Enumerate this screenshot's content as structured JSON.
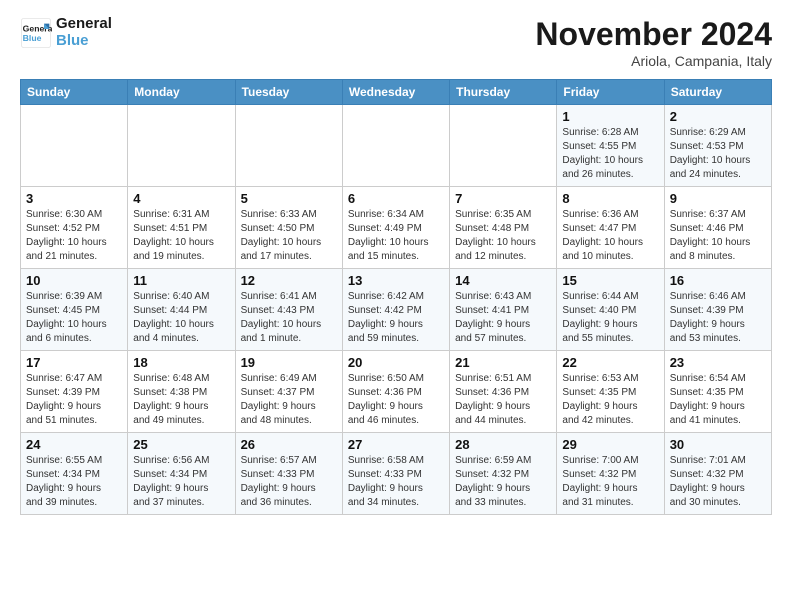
{
  "header": {
    "logo_line1": "General",
    "logo_line2": "Blue",
    "month_title": "November 2024",
    "subtitle": "Ariola, Campania, Italy"
  },
  "weekdays": [
    "Sunday",
    "Monday",
    "Tuesday",
    "Wednesday",
    "Thursday",
    "Friday",
    "Saturday"
  ],
  "weeks": [
    [
      {
        "day": "",
        "info": ""
      },
      {
        "day": "",
        "info": ""
      },
      {
        "day": "",
        "info": ""
      },
      {
        "day": "",
        "info": ""
      },
      {
        "day": "",
        "info": ""
      },
      {
        "day": "1",
        "info": "Sunrise: 6:28 AM\nSunset: 4:55 PM\nDaylight: 10 hours\nand 26 minutes."
      },
      {
        "day": "2",
        "info": "Sunrise: 6:29 AM\nSunset: 4:53 PM\nDaylight: 10 hours\nand 24 minutes."
      }
    ],
    [
      {
        "day": "3",
        "info": "Sunrise: 6:30 AM\nSunset: 4:52 PM\nDaylight: 10 hours\nand 21 minutes."
      },
      {
        "day": "4",
        "info": "Sunrise: 6:31 AM\nSunset: 4:51 PM\nDaylight: 10 hours\nand 19 minutes."
      },
      {
        "day": "5",
        "info": "Sunrise: 6:33 AM\nSunset: 4:50 PM\nDaylight: 10 hours\nand 17 minutes."
      },
      {
        "day": "6",
        "info": "Sunrise: 6:34 AM\nSunset: 4:49 PM\nDaylight: 10 hours\nand 15 minutes."
      },
      {
        "day": "7",
        "info": "Sunrise: 6:35 AM\nSunset: 4:48 PM\nDaylight: 10 hours\nand 12 minutes."
      },
      {
        "day": "8",
        "info": "Sunrise: 6:36 AM\nSunset: 4:47 PM\nDaylight: 10 hours\nand 10 minutes."
      },
      {
        "day": "9",
        "info": "Sunrise: 6:37 AM\nSunset: 4:46 PM\nDaylight: 10 hours\nand 8 minutes."
      }
    ],
    [
      {
        "day": "10",
        "info": "Sunrise: 6:39 AM\nSunset: 4:45 PM\nDaylight: 10 hours\nand 6 minutes."
      },
      {
        "day": "11",
        "info": "Sunrise: 6:40 AM\nSunset: 4:44 PM\nDaylight: 10 hours\nand 4 minutes."
      },
      {
        "day": "12",
        "info": "Sunrise: 6:41 AM\nSunset: 4:43 PM\nDaylight: 10 hours\nand 1 minute."
      },
      {
        "day": "13",
        "info": "Sunrise: 6:42 AM\nSunset: 4:42 PM\nDaylight: 9 hours\nand 59 minutes."
      },
      {
        "day": "14",
        "info": "Sunrise: 6:43 AM\nSunset: 4:41 PM\nDaylight: 9 hours\nand 57 minutes."
      },
      {
        "day": "15",
        "info": "Sunrise: 6:44 AM\nSunset: 4:40 PM\nDaylight: 9 hours\nand 55 minutes."
      },
      {
        "day": "16",
        "info": "Sunrise: 6:46 AM\nSunset: 4:39 PM\nDaylight: 9 hours\nand 53 minutes."
      }
    ],
    [
      {
        "day": "17",
        "info": "Sunrise: 6:47 AM\nSunset: 4:39 PM\nDaylight: 9 hours\nand 51 minutes."
      },
      {
        "day": "18",
        "info": "Sunrise: 6:48 AM\nSunset: 4:38 PM\nDaylight: 9 hours\nand 49 minutes."
      },
      {
        "day": "19",
        "info": "Sunrise: 6:49 AM\nSunset: 4:37 PM\nDaylight: 9 hours\nand 48 minutes."
      },
      {
        "day": "20",
        "info": "Sunrise: 6:50 AM\nSunset: 4:36 PM\nDaylight: 9 hours\nand 46 minutes."
      },
      {
        "day": "21",
        "info": "Sunrise: 6:51 AM\nSunset: 4:36 PM\nDaylight: 9 hours\nand 44 minutes."
      },
      {
        "day": "22",
        "info": "Sunrise: 6:53 AM\nSunset: 4:35 PM\nDaylight: 9 hours\nand 42 minutes."
      },
      {
        "day": "23",
        "info": "Sunrise: 6:54 AM\nSunset: 4:35 PM\nDaylight: 9 hours\nand 41 minutes."
      }
    ],
    [
      {
        "day": "24",
        "info": "Sunrise: 6:55 AM\nSunset: 4:34 PM\nDaylight: 9 hours\nand 39 minutes."
      },
      {
        "day": "25",
        "info": "Sunrise: 6:56 AM\nSunset: 4:34 PM\nDaylight: 9 hours\nand 37 minutes."
      },
      {
        "day": "26",
        "info": "Sunrise: 6:57 AM\nSunset: 4:33 PM\nDaylight: 9 hours\nand 36 minutes."
      },
      {
        "day": "27",
        "info": "Sunrise: 6:58 AM\nSunset: 4:33 PM\nDaylight: 9 hours\nand 34 minutes."
      },
      {
        "day": "28",
        "info": "Sunrise: 6:59 AM\nSunset: 4:32 PM\nDaylight: 9 hours\nand 33 minutes."
      },
      {
        "day": "29",
        "info": "Sunrise: 7:00 AM\nSunset: 4:32 PM\nDaylight: 9 hours\nand 31 minutes."
      },
      {
        "day": "30",
        "info": "Sunrise: 7:01 AM\nSunset: 4:32 PM\nDaylight: 9 hours\nand 30 minutes."
      }
    ]
  ]
}
